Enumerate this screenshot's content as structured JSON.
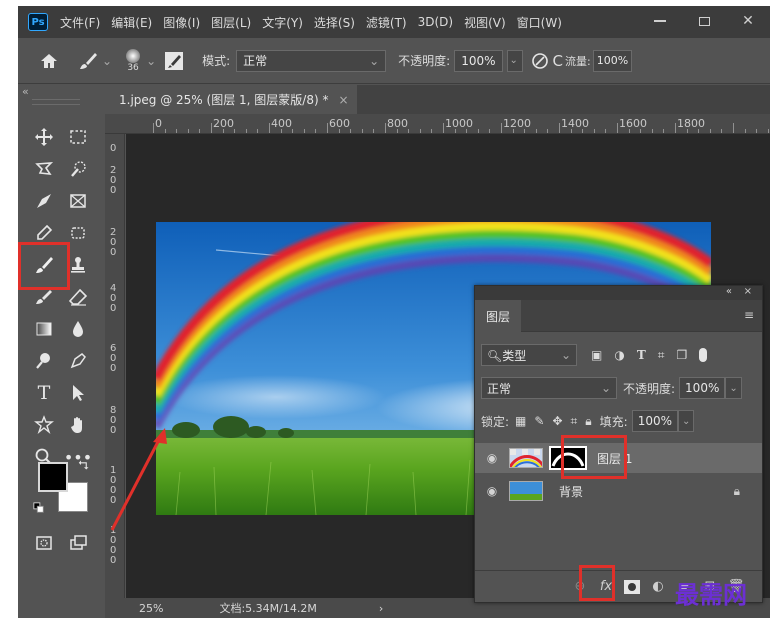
{
  "app": {
    "logo_text": "Ps",
    "menu": [
      "文件(F)",
      "编辑(E)",
      "图像(I)",
      "图层(L)",
      "文字(Y)",
      "选择(S)",
      "滤镜(T)",
      "3D(D)",
      "视图(V)",
      "窗口(W)"
    ]
  },
  "options": {
    "brush_size": "36",
    "mode_label": "模式:",
    "mode_value": "正常",
    "opacity_label": "不透明度:",
    "opacity_value": "100%",
    "flow_label": "流量:",
    "flow_value": "100%"
  },
  "document": {
    "tab_title": "1.jpeg @ 25% (图层 1, 图层蒙版/8) *",
    "close_glyph": "×",
    "ruler_top": [
      "0",
      "200",
      "400",
      "600",
      "800",
      "1000",
      "1200",
      "1400",
      "1600",
      "1800"
    ],
    "ruler_left": [
      "0",
      "200",
      "400",
      "600",
      "800",
      "1000"
    ]
  },
  "status": {
    "zoom": "25%",
    "doc_info": "文档:5.34M/14.2M",
    "arrow_glyph": "›"
  },
  "layers_panel": {
    "collapse_glyph": "«",
    "close_glyph": "×",
    "title": "图层",
    "filter_label": "类型",
    "blend_mode": "正常",
    "opacity_label": "不透明度:",
    "opacity_value": "100%",
    "lock_label": "锁定:",
    "fill_label": "填充:",
    "fill_value": "100%",
    "layers": [
      {
        "name": "图层 1",
        "active": true,
        "has_mask": true
      },
      {
        "name": "背景",
        "active": false,
        "locked": true
      }
    ]
  },
  "toolbar": {
    "collapse_glyph": "«",
    "active_tool": "brush-tool"
  },
  "watermark": "最需网",
  "colors": {
    "highlight": "#e0302a",
    "panel_bg": "#535353",
    "menubar_bg": "#3c3c3c",
    "canvas_bg": "#282828",
    "watermark": "#6c2fd4"
  }
}
